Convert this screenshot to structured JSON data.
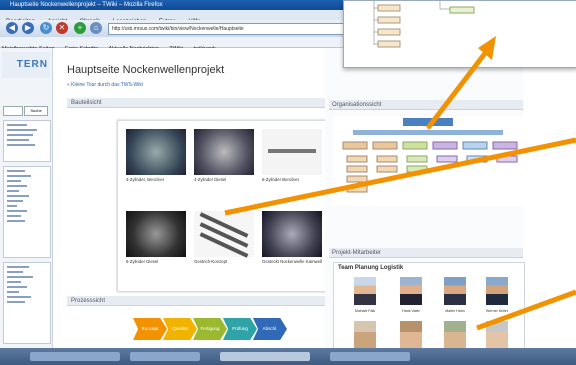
{
  "window": {
    "title": "Hauptseite Nockenwellenprojekt – TWiki – Mozilla Firefox"
  },
  "menu": [
    "Bearbeiten",
    "Ansicht",
    "Chronik",
    "Lesezeichen",
    "Extras",
    "Hilfe"
  ],
  "nav": {
    "address": "http://ssb.mrsus.com/twiki/bin/view/Nockenwelle/Hauptseite"
  },
  "bookmarks": [
    "Meistbesuchte Seiten",
    "Erste Schritte",
    "Aktuelle Nachrichten",
    "TWiki",
    "twikiwork"
  ],
  "sidebar": {
    "logo": "TERN",
    "search_button": "Suche"
  },
  "page": {
    "title": "Hauptseite Nockenwellenprojekt",
    "breadcrumb": "« Kleine Tour durch das TWS-Wiki",
    "sections": {
      "overview": "Bauteilsicht",
      "process": "Prozesssicht"
    }
  },
  "gallery": [
    {
      "caption": "4-Zylinder, Benziner"
    },
    {
      "caption": "4-Zylinder Diesel"
    },
    {
      "caption": "6-Zylinder Benziner"
    },
    {
      "caption": "6-Zylinder Diesel"
    },
    {
      "caption": "Gestrich-Konzept"
    },
    {
      "caption": "Gesteckt Nockenwelle Kamwell"
    }
  ],
  "process_steps": [
    "Konzept",
    "Qualität",
    "Fertigung",
    "Prüfung",
    "Abschl."
  ],
  "right_panel": {
    "org_title": "Organisationssicht",
    "team_section": "Projekt-Mitarbeiter",
    "team_title": "Team Planung Logistik",
    "members": [
      "Michael Falk",
      "Hans Vater",
      "Martin Hahn",
      "Werner Keller"
    ]
  },
  "colors": {
    "accent": "#f39200",
    "titlebar": "#1d5fb0",
    "link": "#3366aa"
  }
}
